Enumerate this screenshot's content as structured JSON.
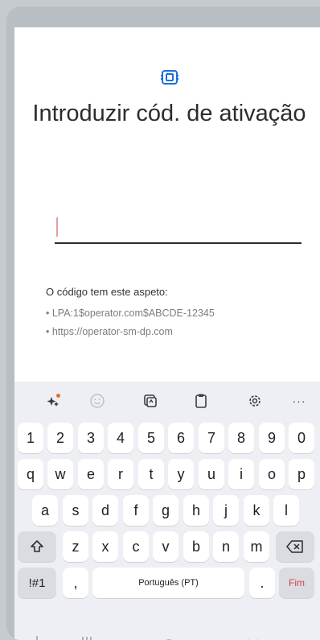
{
  "title": "Introduzir cód. de ativação",
  "input": {
    "value": ""
  },
  "hint": {
    "title": "O código tem este aspeto:",
    "examples": [
      "• LPA:1$operator.com$ABCDE-12345",
      "• https://operator-sm-dp.com"
    ]
  },
  "keyboard": {
    "toolbar": [
      "sparkle-icon",
      "emoji-icon",
      "sticker-icon",
      "clipboard-icon",
      "settings-icon",
      "more-icon"
    ],
    "more_label": "···",
    "rows": [
      [
        "1",
        "2",
        "3",
        "4",
        "5",
        "6",
        "7",
        "8",
        "9",
        "0"
      ],
      [
        "q",
        "w",
        "e",
        "r",
        "t",
        "y",
        "u",
        "i",
        "o",
        "p"
      ],
      [
        "a",
        "s",
        "d",
        "f",
        "g",
        "h",
        "j",
        "k",
        "l"
      ],
      [
        "z",
        "x",
        "c",
        "v",
        "b",
        "n",
        "m"
      ]
    ],
    "symbols_label": "!#1",
    "comma_label": ",",
    "space_label": "Português (PT)",
    "period_label": ".",
    "done_label": "Fim",
    "accent_color": "#d5434e"
  }
}
